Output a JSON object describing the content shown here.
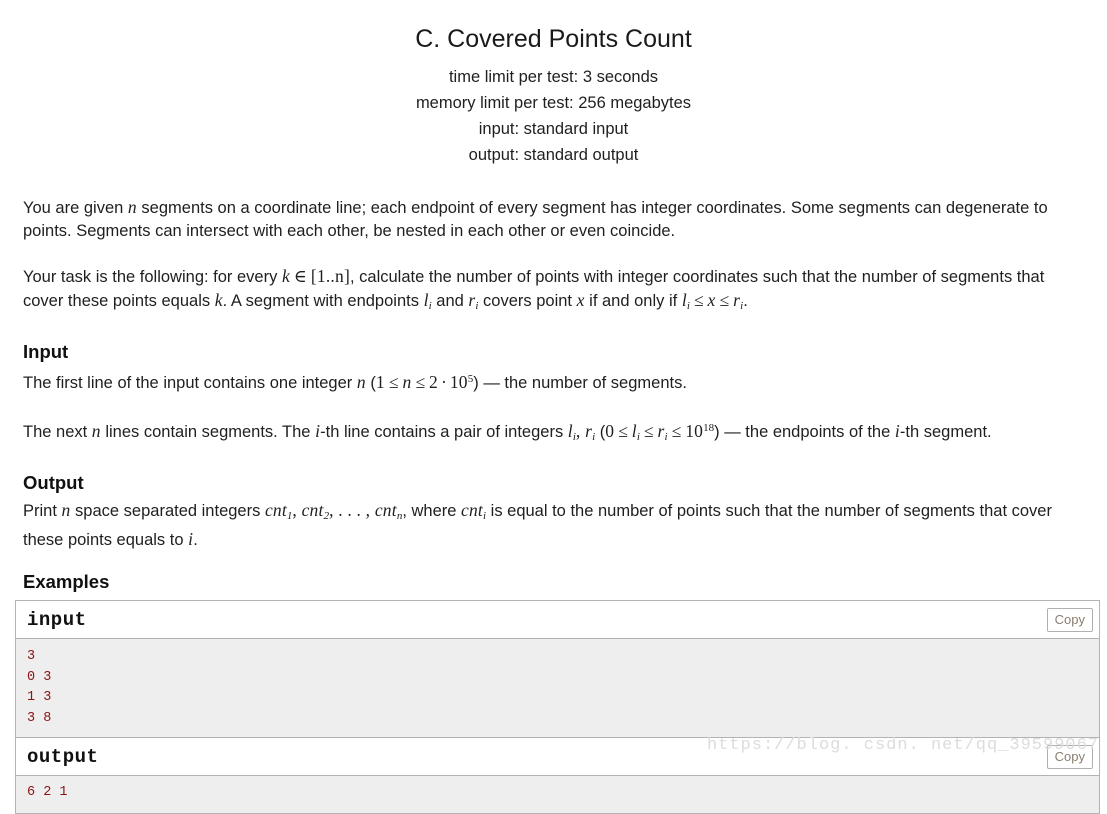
{
  "header": {
    "title": "C. Covered Points Count",
    "limits": [
      "time limit per test: 3 seconds",
      "memory limit per test: 256 megabytes",
      "input: standard input",
      "output: standard output"
    ]
  },
  "statement": {
    "paragraph1": {
      "t1": "You are given ",
      "n": "n",
      "t2": " segments on a coordinate line; each endpoint of every segment has integer coordinates. Some segments can degenerate to points. Segments can intersect with each other, be nested in each other or even coincide."
    },
    "paragraph2": {
      "t1": "Your task is the following: for every ",
      "k": "k",
      "rel_in": "∈",
      "range": "[1..n]",
      "t2": ", calculate the number of points with integer coordinates such that the number of segments that cover these points equals ",
      "k2": "k",
      "t3": ". A segment with endpoints ",
      "l_i": "l",
      "l_i_sub": "i",
      "t4": " and ",
      "r_i": "r",
      "r_i_sub": "i",
      "t5": " covers point ",
      "x": "x",
      "t6": " if and only if ",
      "ineq_l": "l",
      "ineq_l_sub": "i",
      "le1": "≤",
      "ineq_x": "x",
      "le2": "≤",
      "ineq_r": "r",
      "ineq_r_sub": "i",
      "t7": "."
    }
  },
  "input_section": {
    "heading": "Input",
    "line1": {
      "t1": "The first line of the input contains one integer ",
      "n": "n",
      "t2": " (",
      "one": "1",
      "le1": "≤",
      "n2": "n",
      "le2": "≤",
      "two": "2",
      "cdot": "·",
      "ten": "10",
      "exp": "5",
      "t3": ") ",
      "dash": "—",
      "t4": " the number of segments."
    },
    "line2": {
      "t1": "The next ",
      "n": "n",
      "t2": " lines contain segments. The ",
      "i": "i",
      "t3": "-th line contains a pair of integers ",
      "l": "l",
      "l_sub": "i",
      "comma": ", ",
      "r": "r",
      "r_sub": "i",
      "t4": " (",
      "zero": "0",
      "le1": "≤",
      "l2": "l",
      "l2_sub": "i",
      "le2": "≤",
      "r2": "r",
      "r2_sub": "i",
      "le3": "≤",
      "ten": "10",
      "exp": "18",
      "t5": ") ",
      "dash": "—",
      "t6": " the endpoints of the ",
      "i2": "i",
      "t7": "-th segment."
    }
  },
  "output_section": {
    "heading": "Output",
    "line1": {
      "t1": "Print ",
      "n": "n",
      "t2": " space separated integers ",
      "cnt1": "cnt",
      "cnt1_sub": "1",
      "c1": ", ",
      "cnt2": "cnt",
      "cnt2_sub": "2",
      "c2": ", ",
      "dots": ". . . ",
      "c3": ", ",
      "cntn": "cnt",
      "cntn_sub": "n",
      "t3": ", where ",
      "cnti": "cnt",
      "cnti_sub": "i",
      "t4": " is equal to the number of points such that the number of segments that cover these points equals to ",
      "i": "i",
      "t5": "."
    }
  },
  "examples": {
    "heading": "Examples",
    "input": {
      "label": "input",
      "copy_label": "Copy",
      "data": "3\n0 3\n1 3\n3 8"
    },
    "output": {
      "label": "output",
      "copy_label": "Copy",
      "data": "6 2 1"
    }
  },
  "watermark": {
    "text": "https://blog. csdn. net/qq_39599067"
  },
  "colors": {
    "sample_data_text": "#8a1414",
    "sample_data_bg": "#eeeeee",
    "border": "#b3b3b3",
    "copy_text": "#8a7f70",
    "watermark": "#dcdcdc"
  }
}
